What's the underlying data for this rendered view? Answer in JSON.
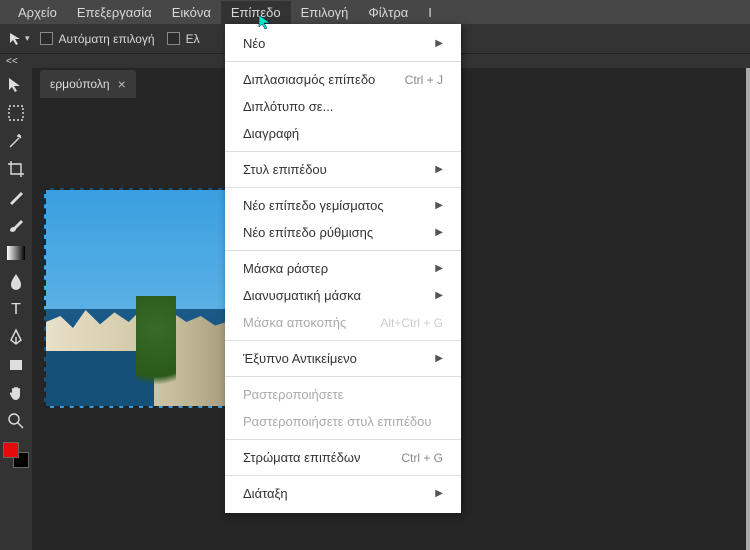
{
  "menubar": {
    "items": [
      "Αρχείο",
      "Επεξεργασία",
      "Εικόνα",
      "Επίπεδο",
      "Επιλογή",
      "Φίλτρα",
      "Ι"
    ],
    "active_index": 3
  },
  "options_bar": {
    "auto_select_label": "Αυτόματη επιλογή",
    "el_label": "Ελ"
  },
  "document": {
    "tab_title": "ερμούπολη"
  },
  "dropdown": {
    "items": [
      {
        "label": "Νέο",
        "submenu": true
      },
      {
        "sep": true
      },
      {
        "label": "Διπλασιασμός επίπεδο",
        "shortcut": "Ctrl + J"
      },
      {
        "label": "Διπλότυπο σε..."
      },
      {
        "label": "Διαγραφή"
      },
      {
        "sep": true
      },
      {
        "label": "Στυλ επιπέδου",
        "submenu": true
      },
      {
        "sep": true
      },
      {
        "label": "Νέο επίπεδο γεμίσματος",
        "submenu": true
      },
      {
        "label": "Νέο επίπεδο ρύθμισης",
        "submenu": true
      },
      {
        "sep": true
      },
      {
        "label": "Μάσκα ράστερ",
        "submenu": true
      },
      {
        "label": "Διανυσματική μάσκα",
        "submenu": true
      },
      {
        "label": "Μάσκα αποκοπής",
        "shortcut": "Alt+Ctrl + G",
        "disabled": true
      },
      {
        "sep": true
      },
      {
        "label": "Έξυπνο Αντικείμενο",
        "submenu": true
      },
      {
        "sep": true
      },
      {
        "label": "Ραστεροποιήσετε",
        "disabled": true
      },
      {
        "label": "Ραστεροποιήσετε στυλ επιπέδου",
        "disabled": true
      },
      {
        "sep": true
      },
      {
        "label": "Στρώματα επιπέδων",
        "shortcut": "Ctrl + G"
      },
      {
        "sep": true
      },
      {
        "label": "Διάταξη",
        "submenu": true
      }
    ]
  },
  "tools": [
    "move",
    "marquee",
    "wand",
    "crop",
    "eyedropper",
    "brush",
    "gradient",
    "blur",
    "type",
    "pen",
    "shape",
    "hand",
    "zoom"
  ],
  "colors": {
    "foreground": "#e30b0b",
    "background": "#000000"
  }
}
